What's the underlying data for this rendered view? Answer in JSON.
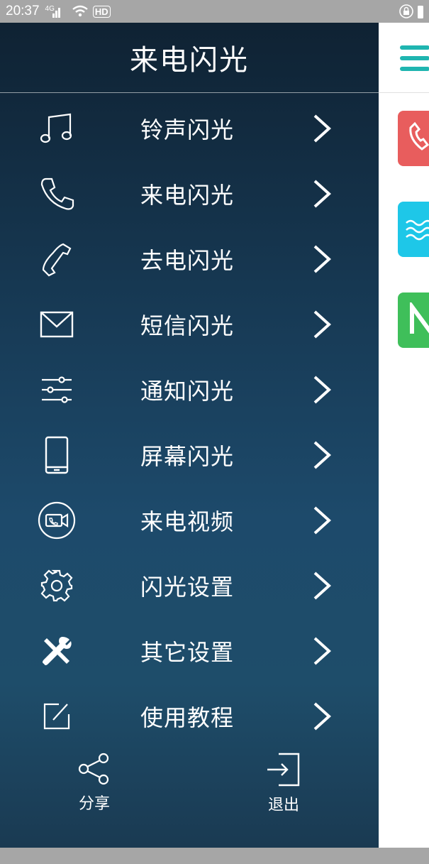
{
  "status_bar": {
    "time": "20:37",
    "network": "4G",
    "extra": "HD"
  },
  "drawer": {
    "title": "来电闪光",
    "items": [
      {
        "label": "铃声闪光",
        "icon": "music-note-icon"
      },
      {
        "label": "来电闪光",
        "icon": "phone-icon"
      },
      {
        "label": "去电闪光",
        "icon": "handset-icon"
      },
      {
        "label": "短信闪光",
        "icon": "envelope-icon"
      },
      {
        "label": "通知闪光",
        "icon": "sliders-icon"
      },
      {
        "label": "屏幕闪光",
        "icon": "smartphone-icon"
      },
      {
        "label": "来电视频",
        "icon": "video-call-icon"
      },
      {
        "label": "闪光设置",
        "icon": "gear-icon"
      },
      {
        "label": "其它设置",
        "icon": "tools-icon"
      },
      {
        "label": "使用教程",
        "icon": "edit-icon"
      }
    ],
    "share_label": "分享",
    "exit_label": "退出"
  },
  "colors": {
    "card_red": "#e85d5d",
    "card_cyan": "#1ec7e8",
    "card_green": "#3fbf5a",
    "hamburger": "#1fb5b0"
  }
}
